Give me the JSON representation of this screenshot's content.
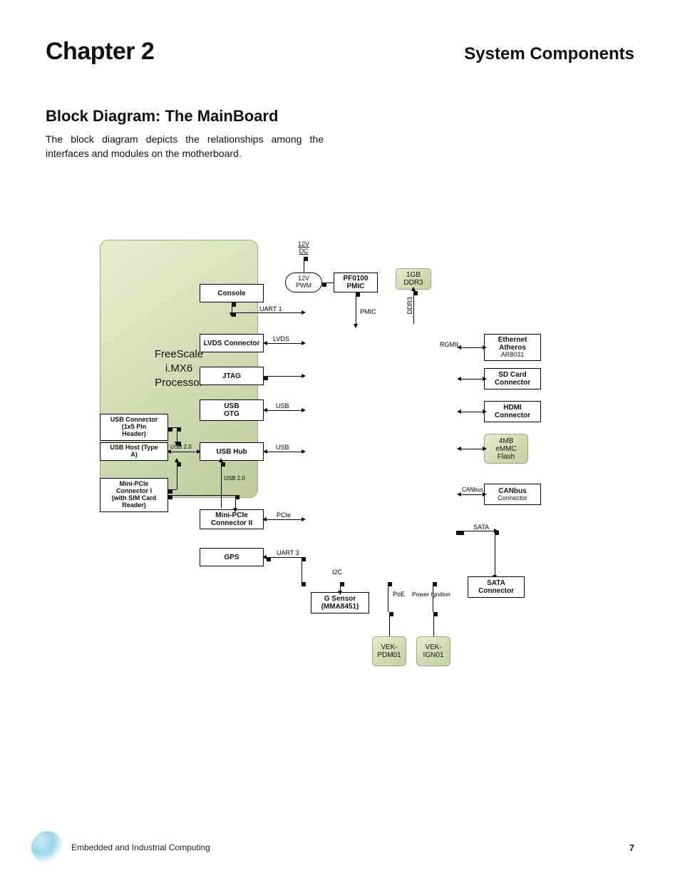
{
  "header": {
    "chapter": "Chapter 2",
    "title": "System Components"
  },
  "section": {
    "title": "Block Diagram: The MainBoard"
  },
  "body": {
    "text": "The block diagram depicts the relationships among the interfaces and modules on the motherboard."
  },
  "footer": {
    "text": "Embedded and Industrial Computing",
    "page": "7"
  },
  "blocks": {
    "pwr_12vdc": "12V\nDC",
    "pwr_12vpwm": "12V\nPWM",
    "pmic": "PF0100\nPMIC",
    "ddr3": "1GB\nDDR3",
    "console": "Console",
    "lvds_conn": "LVDS Connector",
    "jtag": "JTAG",
    "usb_otg": "USB\nOTG",
    "usb_hub": "USB Hub",
    "usb_conn_hdr": "USB Connector\n(1x5 Pin\nHeader)",
    "usb_host_a": "USB Host (Type\nA)",
    "mini_pcie_1": "Mini-PCIe\nConnector I\n(with SIM Card\nReader)",
    "mini_pcie_2": "Mini-PCIe\nConnector II",
    "gps": "GPS",
    "g_sensor": "G Sensor\n(MMA8451)",
    "eth": {
      "name": "Ethernet\nAtheros",
      "sub": "AR8031"
    },
    "sd": "SD Card\nConnector",
    "hdmi": "HDMI\nConnector",
    "emmc": "4MB\neMMC\nFlash",
    "canbus": {
      "name": "CANbus",
      "sub": "Connector"
    },
    "sata": "SATA\nConnector",
    "vek_pdm01": "VEK-\nPDM01",
    "vek_ign01": "VEK-\nIGN01",
    "processor": "FreeScale\ni.MX6\nProcessor"
  },
  "conn_labels": {
    "pmic": "PMIC",
    "ddr3": "DDR3",
    "uart1": "UART 1",
    "lvds": "LVDS",
    "rgmii": "RGMII",
    "usb": "USB",
    "usb2": "USB",
    "usb20_a": "USB 2.0",
    "usb20_b": "USB 2.0",
    "pcie": "PCIe",
    "canbus": "CANbus",
    "sata": "SATA",
    "uart3": "UART 3",
    "i2c": "I2C",
    "poe": "PoE",
    "pwr_ign": "Power Ignition"
  }
}
